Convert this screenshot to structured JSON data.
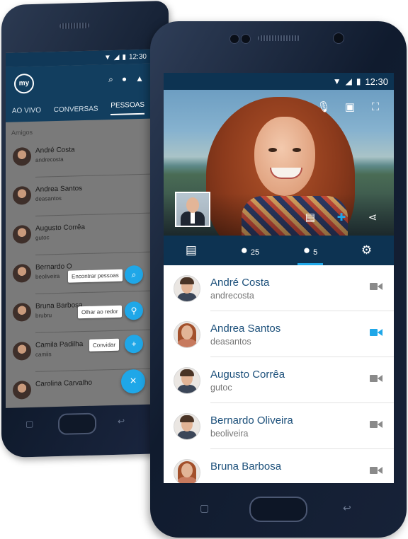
{
  "back_phone": {
    "status_time": "12:30",
    "logo_text": "my",
    "tabs": [
      "AO VIVO",
      "CONVERSAS",
      "PESSOAS"
    ],
    "active_tab": 2,
    "section_label": "Amigos",
    "contacts": [
      {
        "name": "André Costa",
        "username": "andrecosta"
      },
      {
        "name": "Andrea Santos",
        "username": "deasantos"
      },
      {
        "name": "Augusto Corrêa",
        "username": "gutoc"
      },
      {
        "name": "Bernardo O",
        "username": "beoliveira"
      },
      {
        "name": "Bruna Barbosa",
        "username": "brubru"
      },
      {
        "name": "Camila Padilha",
        "username": "camiis"
      },
      {
        "name": "Carolina Carvalho",
        "username": ""
      }
    ],
    "fab_menu": {
      "find_people": "Encontrar pessoas",
      "look_around": "Olhar ao redor",
      "invite": "Convidar",
      "close_glyph": "×"
    }
  },
  "front_phone": {
    "status_time": "12:30",
    "toolbar": {
      "friends_count": "25",
      "online_count": "5"
    },
    "contacts": [
      {
        "name": "André Costa",
        "username": "andrecosta",
        "video_active": false
      },
      {
        "name": "Andrea Santos",
        "username": "deasantos",
        "video_active": true
      },
      {
        "name": "Augusto Corrêa",
        "username": "gutoc",
        "video_active": false
      },
      {
        "name": "Bernardo Oliveira",
        "username": "beoliveira",
        "video_active": false
      },
      {
        "name": "Bruna Barbosa",
        "username": "",
        "video_active": false
      }
    ]
  },
  "colors": {
    "primary_dark": "#0d3352",
    "accent": "#1fa7e8",
    "name_text": "#1b4f7a",
    "username_text": "#777777",
    "cam_inactive": "#8a8a8a"
  },
  "icons": {
    "mic": "microphone-icon",
    "switch_camera": "switch-camera-icon",
    "fullscreen": "fullscreen-icon",
    "chat": "chat-icon",
    "add_contact": "add-contact-icon",
    "share": "share-icon",
    "conversations": "conversations-icon",
    "friends": "friends-icon",
    "online": "online-people-icon",
    "settings": "gear-icon"
  }
}
